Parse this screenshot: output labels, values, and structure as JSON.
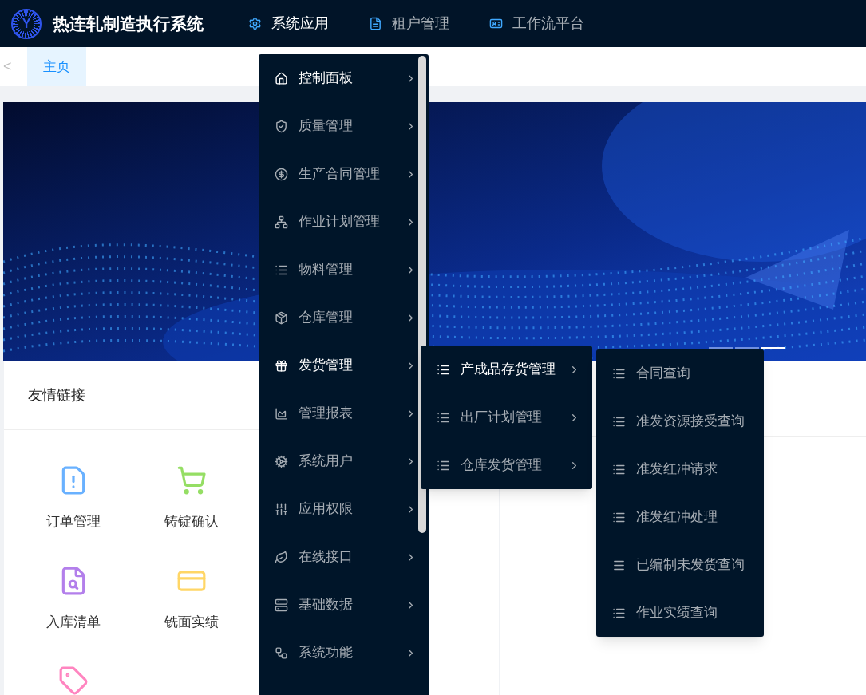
{
  "header": {
    "logo_mark": "Y",
    "title": "热连轧制造执行系统",
    "nav": [
      {
        "label": "系统应用",
        "selected": true
      },
      {
        "label": "租户管理",
        "selected": false
      },
      {
        "label": "工作流平台",
        "selected": false
      }
    ]
  },
  "tab_bar": {
    "back": "<",
    "tabs": [
      {
        "label": "主页",
        "selected": true
      }
    ]
  },
  "banner": {
    "indicators": [
      {
        "selected": false
      },
      {
        "selected": false
      },
      {
        "selected": true
      }
    ]
  },
  "links_card": {
    "title": "友情链接",
    "items": [
      {
        "label": "订单管理",
        "color": "#69b1ff"
      },
      {
        "label": "铸锭确认",
        "color": "#95de64"
      },
      {
        "label": "入库清单",
        "color": "#b37feb"
      },
      {
        "label": "铣面实绩",
        "color": "#ffd666"
      },
      {
        "color": "#ff85c0"
      }
    ]
  },
  "menu": {
    "items": [
      {
        "label": "控制面板",
        "active": true
      },
      {
        "label": "质量管理",
        "active": false
      },
      {
        "label": "生产合同管理",
        "active": false
      },
      {
        "label": "作业计划管理",
        "active": false
      },
      {
        "label": "物料管理",
        "active": false
      },
      {
        "label": "仓库管理",
        "active": false
      },
      {
        "label": "发货管理",
        "active": true
      },
      {
        "label": "管理报表",
        "active": false
      },
      {
        "label": "系统用户",
        "active": false
      },
      {
        "label": "应用权限",
        "active": false
      },
      {
        "label": "在线接口",
        "active": false
      },
      {
        "label": "基础数据",
        "active": false
      },
      {
        "label": "系统功能",
        "active": false
      }
    ]
  },
  "submenu": {
    "items": [
      {
        "label": "产成品存货管理",
        "active": true
      },
      {
        "label": "出厂计划管理",
        "active": false
      },
      {
        "label": "仓库发货管理",
        "active": false
      }
    ]
  },
  "submenu_2": {
    "items": [
      {
        "label": "合同查询",
        "active": false
      },
      {
        "label": "准发资源接受查询",
        "active": false
      },
      {
        "label": "准发红冲请求",
        "active": false
      },
      {
        "label": "准发红冲处理",
        "active": false
      },
      {
        "label": "已编制未发货查询",
        "active": false
      },
      {
        "label": "作业实绩查询",
        "active": false
      }
    ]
  }
}
